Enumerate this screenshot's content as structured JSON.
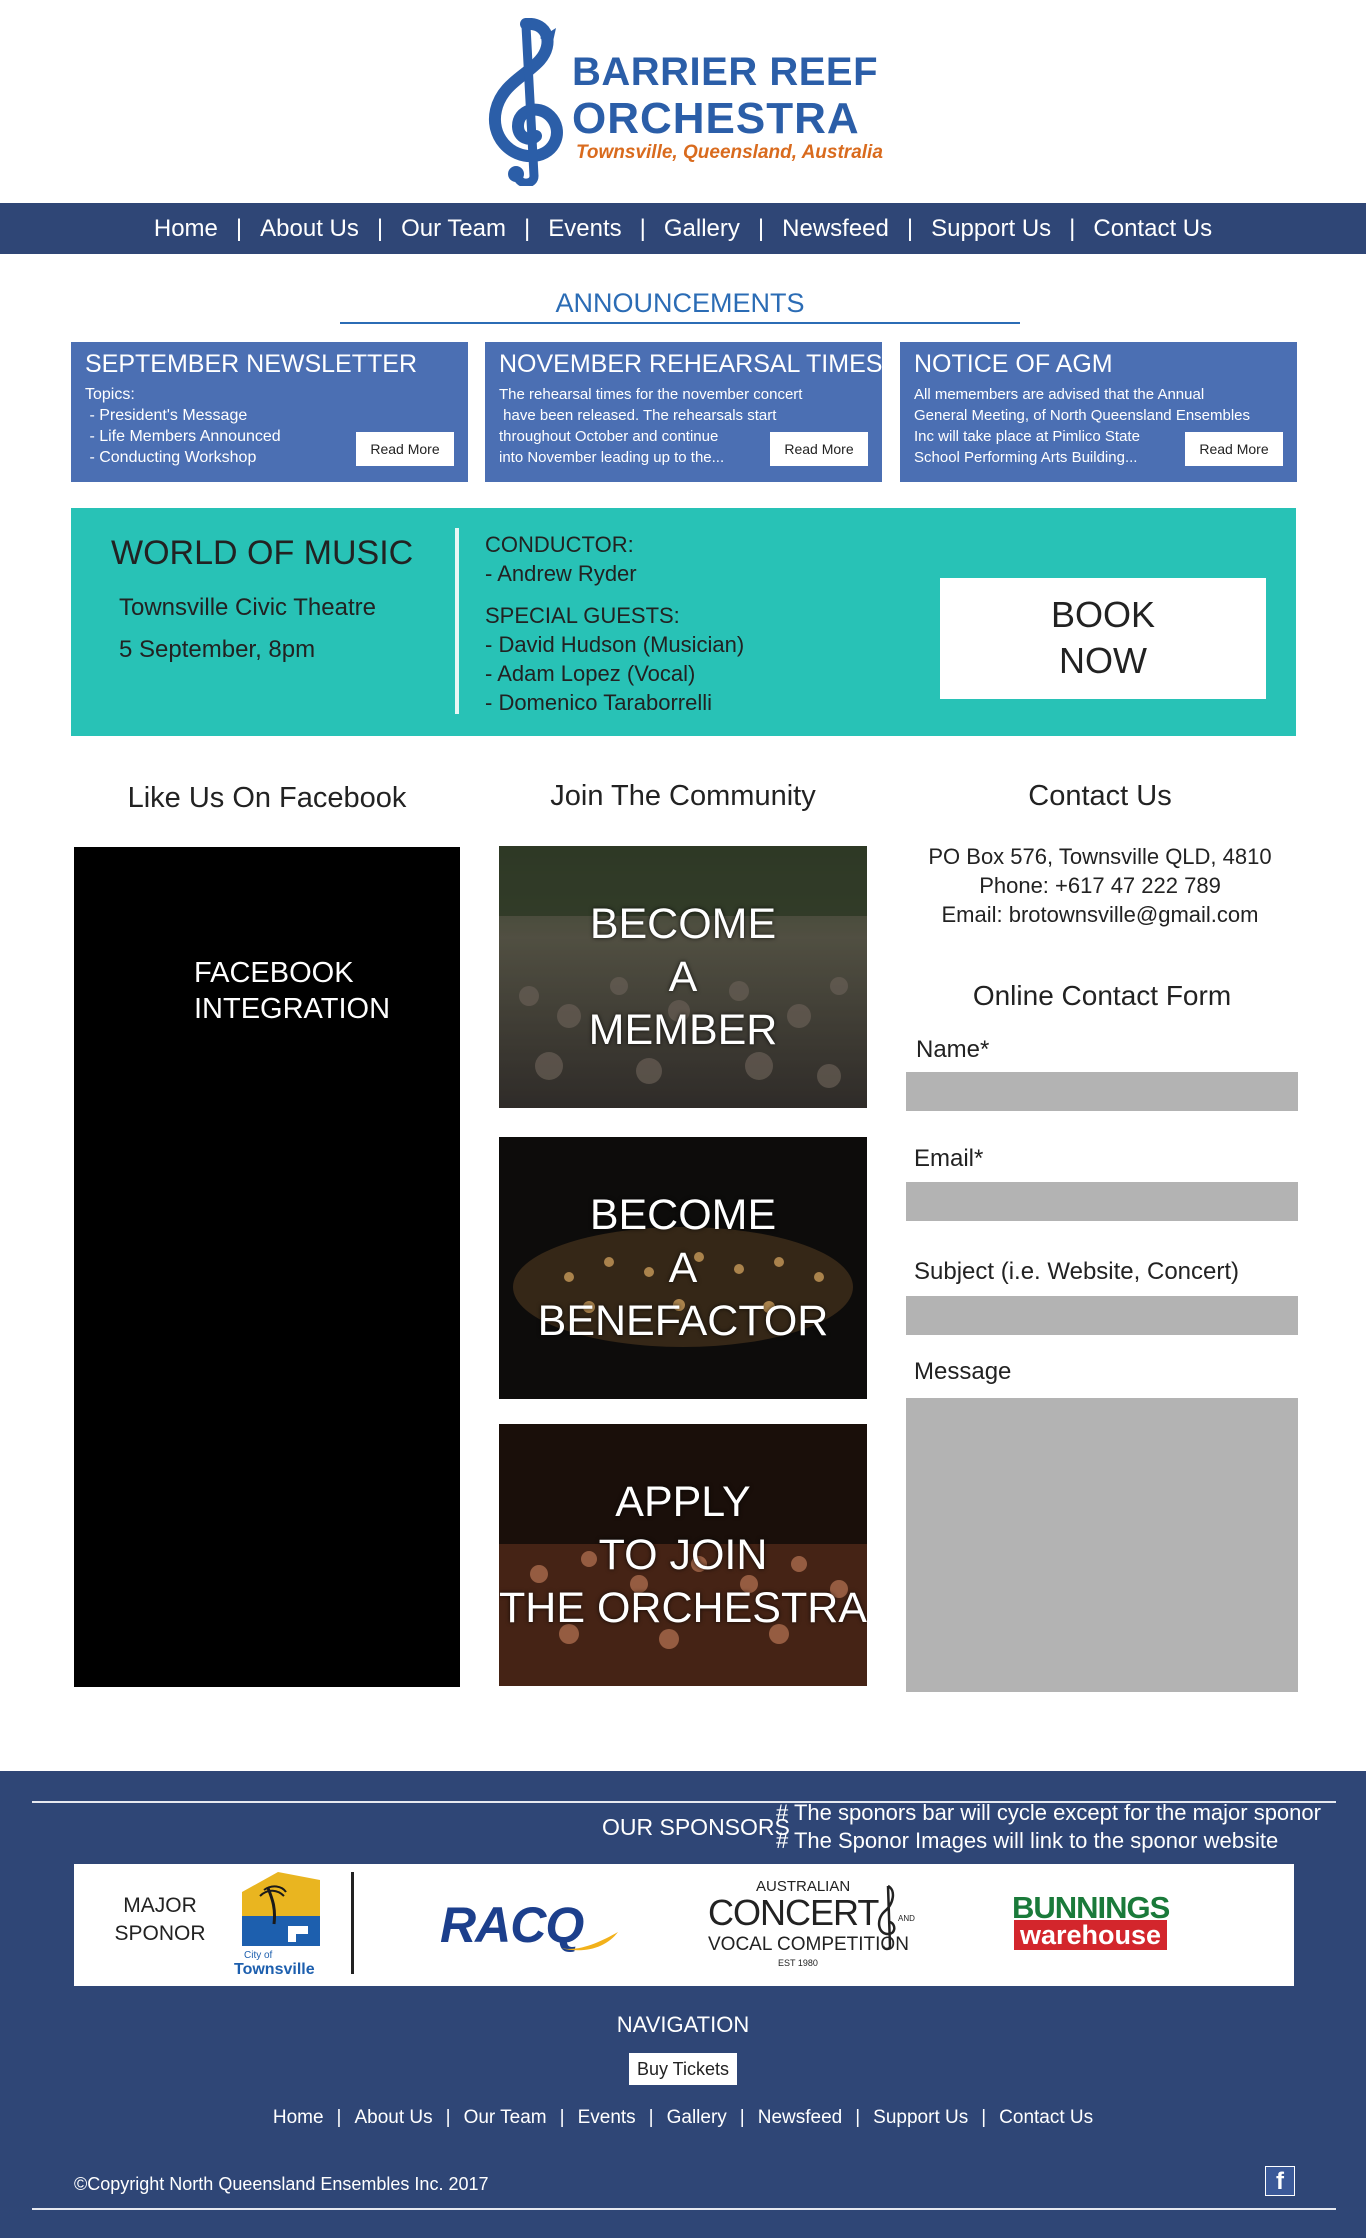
{
  "header": {
    "logo": {
      "line1": "BARRIER REEF",
      "line2": "ORCHESTRA",
      "line3": "Townsville, Queensland, Australia"
    }
  },
  "nav": {
    "items": [
      "Home",
      "About Us",
      "Our Team",
      "Events",
      "Gallery",
      "Newsfeed",
      "Support Us",
      "Contact Us"
    ]
  },
  "announcements": {
    "title": "ANNOUNCEMENTS",
    "cards": [
      {
        "heading": "SEPTEMBER NEWSLETTER",
        "lines": [
          "Topics:",
          " - President's Message",
          " - Life Members Announced",
          " - Conducting Workshop"
        ],
        "button": "Read More"
      },
      {
        "heading": "NOVEMBER REHEARSAL TIMES",
        "lines": [
          "The rehearsal times for the november concert",
          " have been released. The rehearsals start",
          "throughout October and continue",
          "into November leading up to the..."
        ],
        "button": "Read More"
      },
      {
        "heading": "NOTICE OF AGM",
        "lines": [
          "All memembers are advised that the Annual",
          "General Meeting, of North Queensland Ensembles",
          "Inc will take place at Pimlico State",
          "School Performing Arts Building..."
        ],
        "button": "Read More"
      }
    ]
  },
  "event": {
    "title": "WORLD OF MUSIC",
    "venue": "Townsville Civic Theatre",
    "date": "5 September, 8pm",
    "conductor_label": "CONDUCTOR:",
    "conductor": "- Andrew Ryder",
    "guests_label": "SPECIAL GUESTS:",
    "guests": [
      "- David Hudson (Musician)",
      "- Adam Lopez (Vocal)",
      "- Domenico Taraborrelli"
    ],
    "book_line1": "BOOK",
    "book_line2": "NOW"
  },
  "facebook": {
    "title": "Like Us On Facebook",
    "placeholder_line1": "FACEBOOK",
    "placeholder_line2": "INTEGRATION"
  },
  "community": {
    "title": "Join The Community",
    "tiles": [
      {
        "lines": [
          "BECOME",
          "A",
          "MEMBER"
        ]
      },
      {
        "lines": [
          "BECOME",
          "A",
          "BENEFACTOR"
        ]
      },
      {
        "lines": [
          "APPLY",
          "TO JOIN",
          "THE ORCHESTRA"
        ]
      }
    ]
  },
  "contact": {
    "title": "Contact Us",
    "address": "PO Box 576, Townsville QLD, 4810",
    "phone": "Phone: +617 47 222 789",
    "email": "Email: brotownsville@gmail.com",
    "form_title": "Online Contact Form",
    "name_label": "Name*",
    "email_label": "Email*",
    "subject_label": "Subject (i.e. Website, Concert)",
    "message_label": "Message"
  },
  "footer": {
    "sponsors_label": "OUR SPONSORS",
    "note1": "# The sponors bar will cycle except for the major sponor",
    "note2": "# The Sponor Images will link to the sponor website",
    "major_line1": "MAJOR",
    "major_line2": "SPONOR",
    "sponsors": {
      "townsville_line1": "City of",
      "townsville_line2": "Townsville",
      "racq": "RACQ",
      "concert_line1": "AUSTRALIAN",
      "concert_line2": "CONCERT",
      "concert_line3": "VOCAL COMPETITION",
      "concert_line4": "EST 1980",
      "concert_side": "AND",
      "bunnings_line1": "BUNNINGS",
      "bunnings_line2": "warehouse"
    },
    "navigation_title": "NAVIGATION",
    "buy_tickets": "Buy Tickets",
    "nav_items": [
      "Home",
      "About Us",
      "Our Team",
      "Events",
      "Gallery",
      "Newsfeed",
      "Support Us",
      "Contact Us"
    ],
    "copyright": "©Copyright North Queensland Ensembles Inc. 2017",
    "facebook_icon": "f"
  },
  "colors": {
    "nav_bg": "#2f4676",
    "card_bg": "#4b6fb3",
    "event_bg": "#28c2b6",
    "accent_blue": "#2b6cb5",
    "logo_orange": "#d96b1e"
  }
}
